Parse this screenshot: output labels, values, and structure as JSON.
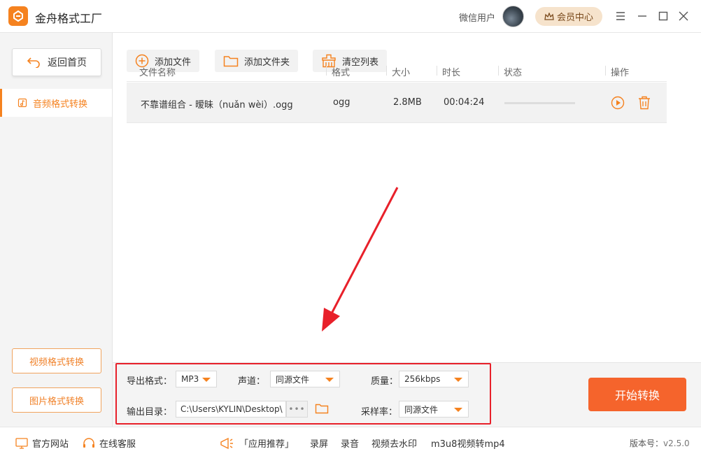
{
  "app": {
    "title": "金舟格式工厂"
  },
  "header": {
    "user_name": "微信用户",
    "vip_label": "会员中心"
  },
  "sidebar": {
    "back_label": "返回首页",
    "active_item": "音频格式转换",
    "video_label": "视频格式转换",
    "image_label": "图片格式转换"
  },
  "toolbar": {
    "add_file": "添加文件",
    "add_folder": "添加文件夹",
    "clear_list": "清空列表"
  },
  "table": {
    "headers": [
      "文件名称",
      "格式",
      "大小",
      "时长",
      "状态",
      "操作"
    ],
    "rows": [
      {
        "name": "不靠谱组合 - 暧昧（nuǎn wèi）.ogg",
        "format": "ogg",
        "size": "2.8MB",
        "duration": "00:04:24",
        "progress": 0
      }
    ]
  },
  "settings": {
    "export_format_label": "导出格式：",
    "export_format_value": "MP3",
    "channel_label": "声道：",
    "channel_value": "同源文件",
    "quality_label": "质量：",
    "quality_value": "256kbps",
    "output_dir_label": "输出目录：",
    "output_dir_value": "C:\\Users\\KYLIN\\Desktop\\",
    "sample_rate_label": "采样率：",
    "sample_rate_value": "同源文件"
  },
  "start_button": "开始转换",
  "statusbar": {
    "website": "官方网站",
    "service": "在线客服",
    "recommend": "「应用推荐」",
    "links": [
      "录屏",
      "录音",
      "视频去水印",
      "m3u8视频转mp4"
    ],
    "version_label": "版本号：",
    "version_value": "v2.5.0"
  },
  "colors": {
    "accent": "#f5821f",
    "start_button": "#f5642c",
    "highlight_box": "#e8202a"
  }
}
